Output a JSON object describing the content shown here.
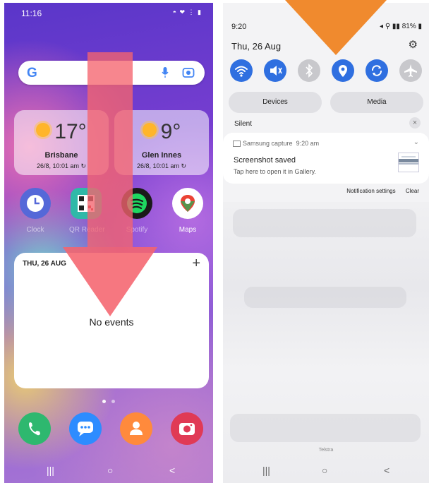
{
  "left": {
    "status": {
      "time": "11:16",
      "icons": "◓ ❤ ⋮ ▮"
    },
    "search": {
      "logo": "G"
    },
    "weather": [
      {
        "temp": "17°",
        "city": "Brisbane",
        "updated": "26/8, 10:01 am ↻"
      },
      {
        "temp": "9°",
        "city": "Glen Innes",
        "updated": "26/8, 10:01 am ↻"
      }
    ],
    "apps": [
      {
        "label": "Clock",
        "icon": "clock-icon",
        "color": "#5568d8"
      },
      {
        "label": "QR Reader",
        "icon": "qr-icon",
        "color": "#2fb9a8"
      },
      {
        "label": "Spotify",
        "icon": "spotify-icon",
        "color": "#1a1a1a"
      },
      {
        "label": "Maps",
        "icon": "maps-icon",
        "color": "#ffffff"
      }
    ],
    "calendar": {
      "date": "THU, 26 AUG",
      "empty_text": "No events",
      "add": "+"
    },
    "dock": [
      {
        "icon": "phone-icon",
        "color": "#2eb86f"
      },
      {
        "icon": "messages-icon",
        "color": "#2d8cff"
      },
      {
        "icon": "contacts-icon",
        "color": "#ff8a3c"
      },
      {
        "icon": "camera-icon",
        "color": "#e03a55"
      }
    ],
    "nav": {
      "recents": "|||",
      "home": "○",
      "back": "<"
    }
  },
  "right": {
    "status": {
      "time": "9:20",
      "battery": "81%"
    },
    "date": "Thu, 26 Aug",
    "gear": "⚙",
    "quick_settings": [
      {
        "name": "wifi",
        "icon": "wifi-icon",
        "on": true
      },
      {
        "name": "sound",
        "icon": "mute-icon",
        "on": true
      },
      {
        "name": "bluetooth",
        "icon": "bluetooth-icon",
        "on": false
      },
      {
        "name": "location",
        "icon": "location-icon",
        "on": true
      },
      {
        "name": "rotate",
        "icon": "rotate-icon",
        "on": true
      },
      {
        "name": "airplane",
        "icon": "airplane-icon",
        "on": false
      }
    ],
    "pills": {
      "devices": "Devices",
      "media": "Media"
    },
    "silent_label": "Silent",
    "notification": {
      "app": "Samsung capture",
      "time": "9:20 am",
      "title": "Screenshot saved",
      "body": "Tap here to open it in Gallery."
    },
    "links": {
      "settings": "Notification settings",
      "clear": "Clear"
    },
    "carrier": "Telstra",
    "nav": {
      "recents": "|||",
      "home": "○",
      "back": "<"
    }
  },
  "colors": {
    "accent": "#2f6fe0",
    "arrow_red": "#f5646e",
    "arrow_orange": "#f08a2e"
  }
}
